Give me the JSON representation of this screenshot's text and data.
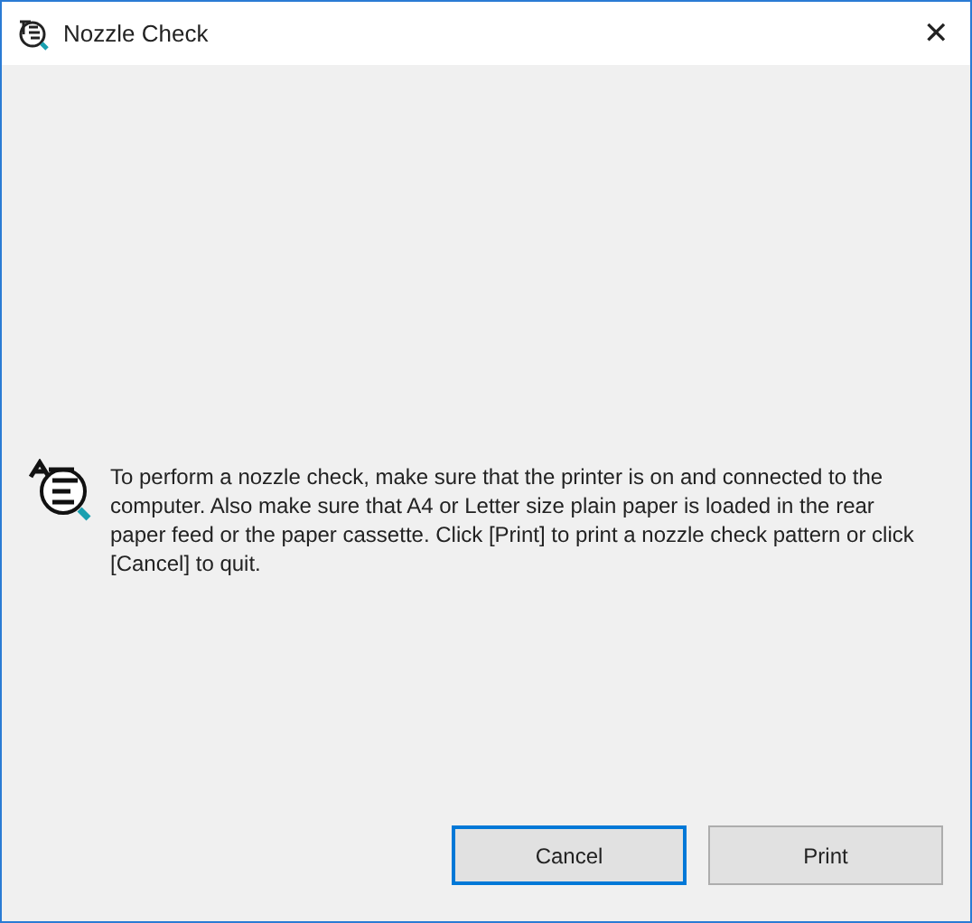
{
  "window": {
    "title": "Nozzle Check",
    "close": "✕"
  },
  "message": "To perform a nozzle check, make sure that the printer is on and connected to the computer. Also make sure that A4 or Letter size plain paper is loaded in the rear paper feed or the paper cassette. Click [Print] to print a nozzle check pattern or click [Cancel] to quit.",
  "buttons": [
    {
      "label": "Cancel",
      "focused": true
    },
    {
      "label": "Print",
      "focused": false
    }
  ]
}
